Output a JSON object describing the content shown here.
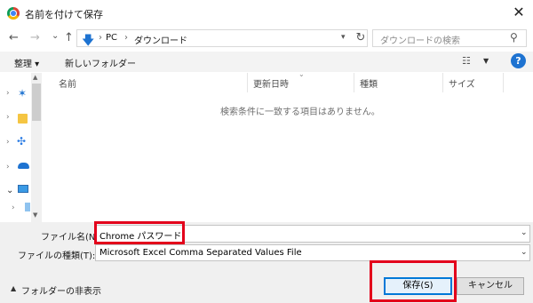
{
  "title": "名前を付けて保存",
  "nav": {
    "back": "←",
    "forward": "→",
    "recent": "⌄",
    "up": "↑",
    "path_sep": "›",
    "path": [
      "PC",
      "ダウンロード"
    ],
    "refresh": "↻",
    "search_placeholder": "ダウンロードの検索"
  },
  "toolbar": {
    "organize_label": "整理 ▾",
    "new_folder_label": "新しいフォルダー",
    "help": "?"
  },
  "columns": [
    "名前",
    "更新日時",
    "種類",
    "サイズ"
  ],
  "empty_message": "検索条件に一致する項目はありません。",
  "fields": {
    "filename_label": "ファイル名(N):",
    "filename_value": "Chrome パスワード",
    "filetype_label": "ファイルの種類(T):",
    "filetype_value": "Microsoft Excel Comma Separated Values File"
  },
  "footer": {
    "hide_folders_label": "フォルダーの非表示",
    "save_label": "保存(S)",
    "cancel_label": "キャンセル"
  },
  "colors": {
    "highlight": "#e3001b",
    "accent": "#0078d7",
    "help_bg": "#1e73d1"
  }
}
